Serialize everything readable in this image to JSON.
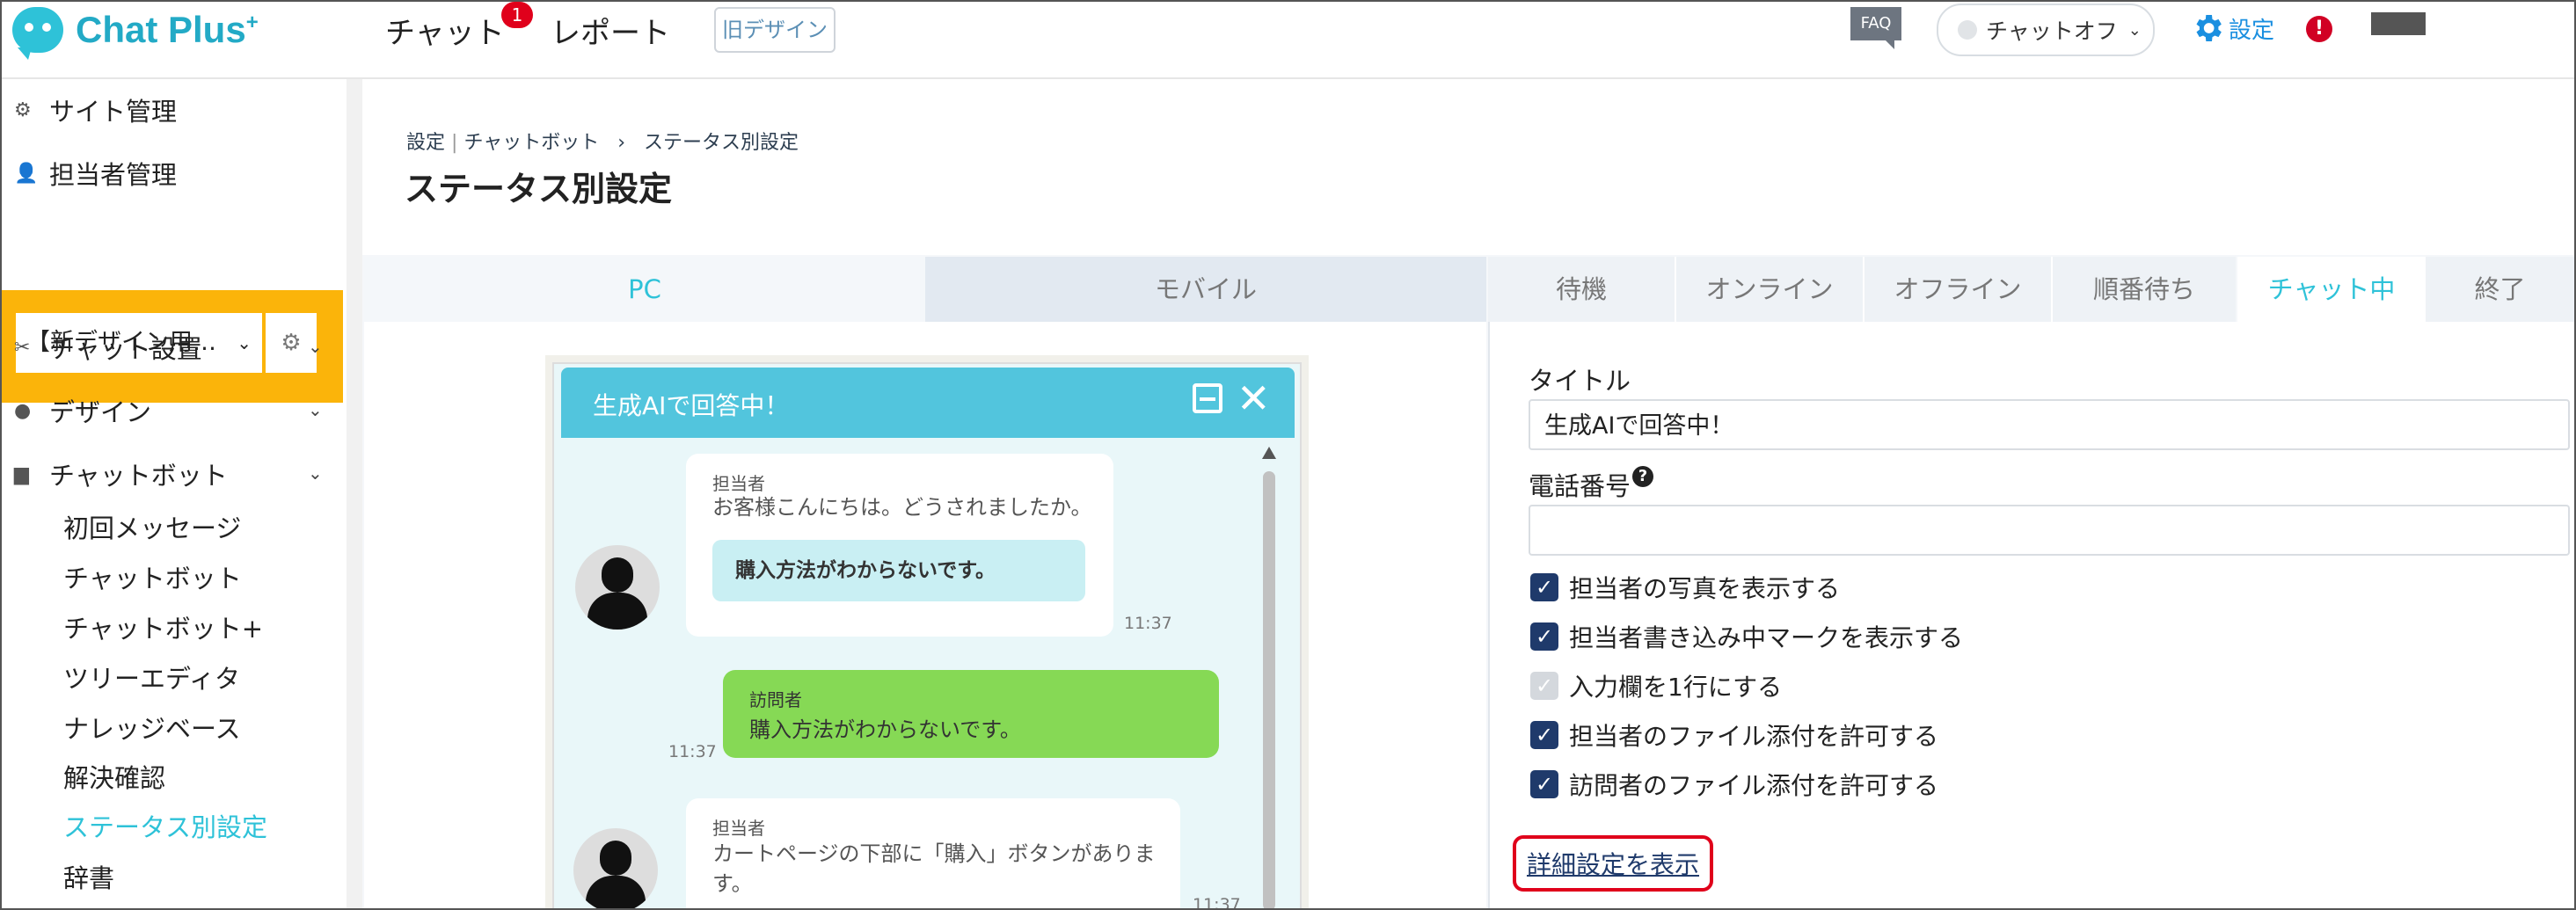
{
  "app": {
    "logo_text": "Chat Plus",
    "logo_sup": "+"
  },
  "topnav": {
    "chat_label": "チャット",
    "chat_badge": "1",
    "report_label": "レポート",
    "old_design_label": "旧デザイン",
    "faq_label": "FAQ",
    "chat_status_label": "チャットオフ",
    "settings_label": "設定",
    "alert_label": "!"
  },
  "sidebar": {
    "site_manage": "サイト管理",
    "staff_manage": "担当者管理",
    "site_select_value": "【新デザイン用…",
    "chat_setup": "チャット設置",
    "design": "デザイン",
    "chatbot": "チャットボット",
    "sub_items": [
      "初回メッセージ",
      "チャットボット",
      "チャットボット+",
      "ツリーエディタ",
      "ナレッジベース",
      "解決確認",
      "ステータス別設定",
      "辞書"
    ],
    "active_sub": "ステータス別設定"
  },
  "page": {
    "breadcrumb_1": "設定",
    "breadcrumb_sep": "|",
    "breadcrumb_2": "チャットボット",
    "breadcrumb_arrow": "›",
    "breadcrumb_3": "ステータス別設定",
    "title": "ステータス別設定"
  },
  "device_tabs": [
    "PC",
    "モバイル"
  ],
  "status_tabs": [
    "待機",
    "オンライン",
    "オフライン",
    "順番待ち",
    "チャット中",
    "終了"
  ],
  "active_status_tab": "チャット中",
  "widget": {
    "title": "生成AIで回答中！",
    "msg1_sender": "担当者",
    "msg1_text": "お客様こんにちは。どうされましたか。",
    "msg1_quick_reply": "購入方法がわからないです。",
    "msg1_time": "11:37",
    "msg2_sender": "訪問者",
    "msg2_text": "購入方法がわからないです。",
    "msg2_time": "11:37",
    "msg3_sender": "担当者",
    "msg3_text_line1": "カートページの下部に「購入」ボタンがありま",
    "msg3_text_line2": "す。",
    "msg3_time": "11:37"
  },
  "form": {
    "title_label": "タイトル",
    "title_value": "生成AIで回答中！",
    "phone_label": "電話番号",
    "phone_value": "",
    "checkboxes": [
      {
        "label": "担当者の写真を表示する",
        "checked": true
      },
      {
        "label": "担当者書き込み中マークを表示する",
        "checked": true
      },
      {
        "label": "入力欄を1行にする",
        "checked": false
      },
      {
        "label": "担当者のファイル添付を許可する",
        "checked": true
      },
      {
        "label": "訪問者のファイル添付を許可する",
        "checked": true
      }
    ],
    "detail_link": "詳細設定を表示"
  },
  "colors": {
    "accent": "#2ec2d8",
    "brand": "#23aac6",
    "sidebar_highlight": "#fbb40a",
    "alert": "#e0001b",
    "checkbox": "#1f3a6b"
  }
}
